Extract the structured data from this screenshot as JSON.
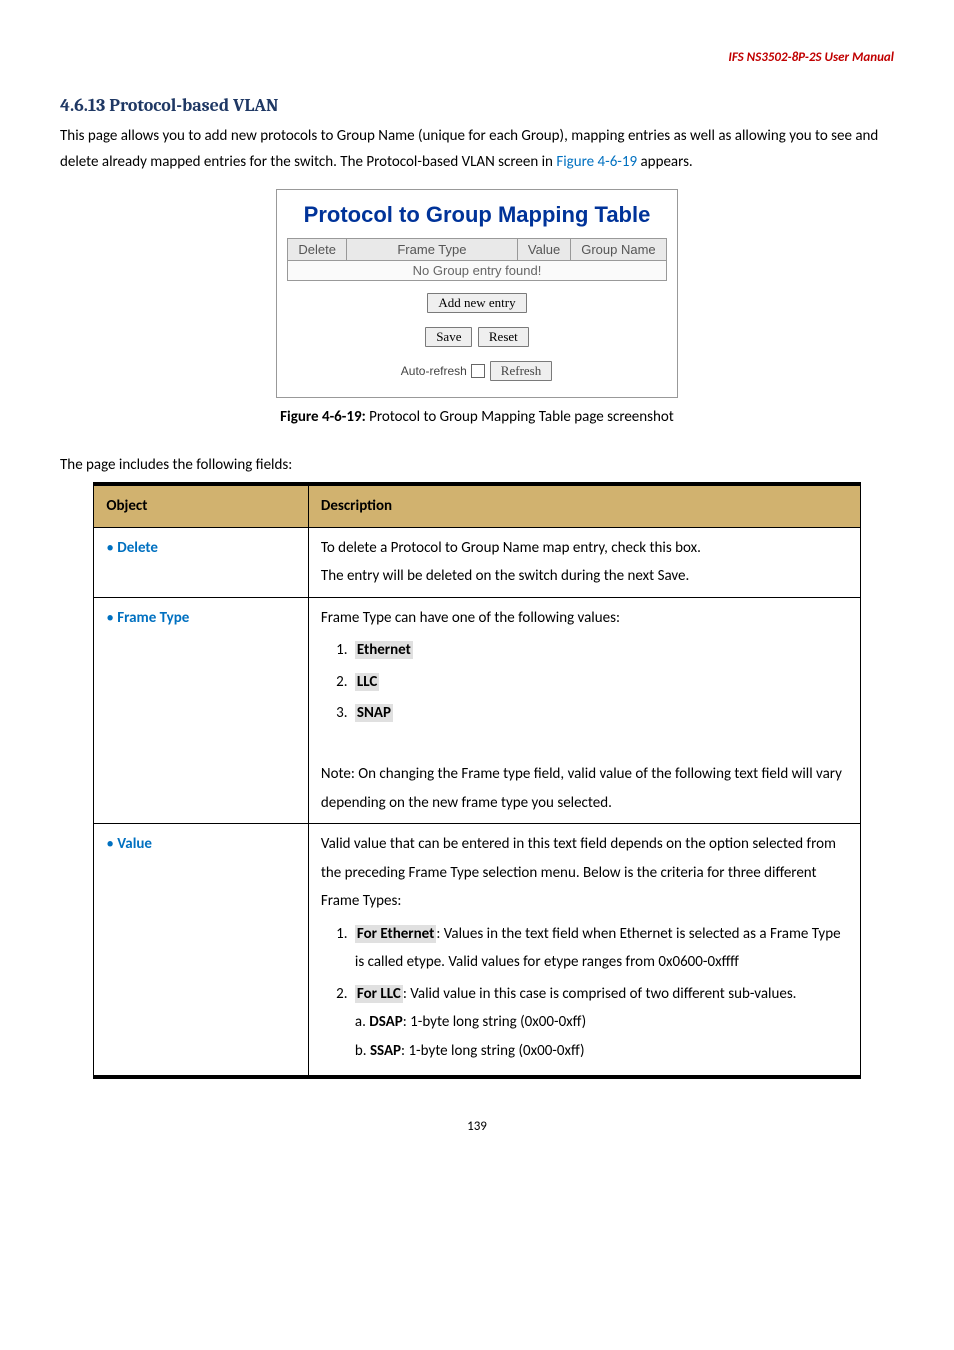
{
  "header": {
    "product": "IFS  NS3502-8P-2S  User  Manual"
  },
  "section": {
    "number": "4.6.13",
    "title": "Protocol-based VLAN",
    "intro_part1": "This page allows you to add new protocols to Group Name (unique for each Group), mapping entries as well as allowing you to see and delete already mapped entries for the switch. The Protocol-based VLAN screen in ",
    "intro_figref": "Figure 4-6-19",
    "intro_part2": " appears."
  },
  "figure": {
    "title": "Protocol to Group Mapping Table",
    "cols": {
      "delete": "Delete",
      "frametype": "Frame Type",
      "value": "Value",
      "groupname": "Group Name"
    },
    "empty_row": "No Group entry found!",
    "buttons": {
      "add": "Add new entry",
      "save": "Save",
      "reset": "Reset",
      "refresh": "Refresh"
    },
    "auto_refresh_label": "Auto-refresh"
  },
  "caption": {
    "label": "Figure 4-6-19:",
    "text": " Protocol to Group Mapping Table page screenshot"
  },
  "fields_intro": "The page includes the following fields:",
  "table": {
    "headers": {
      "object": "Object",
      "description": "Description"
    },
    "rows": {
      "delete": {
        "label": "Delete",
        "line1": "To delete a Protocol to Group Name map entry, check this box.",
        "line2": "The entry will be deleted on the switch during the next Save."
      },
      "frametype": {
        "label": "Frame Type",
        "intro": "Frame Type can have one of the following values:",
        "items": {
          "i1": "Ethernet",
          "i2": "LLC",
          "i3": "SNAP"
        },
        "note": "Note: On changing the Frame type field, valid value of the following text field will vary depending on the new frame type you selected."
      },
      "value": {
        "label": "Value",
        "intro": "Valid value that can be entered in this text field depends on the option selected from the preceding Frame Type selection menu. Below is the criteria for three different Frame Types:",
        "li1_key": "For Ethernet",
        "li1_rest": ": Values in the text field when Ethernet is selected as a Frame Type is called etype. Valid values for etype ranges from 0x0600-0xffff",
        "li2_key": "For LLC",
        "li2_rest": ": Valid value in this case is comprised of two different sub-values.",
        "li2_a_key": "DSAP",
        "li2_a_rest": ": 1-byte long string (0x00-0xff)",
        "li2_b_key": "SSAP",
        "li2_b_rest": ": 1-byte long string (0x00-0xff)"
      }
    }
  },
  "page_number": "139"
}
